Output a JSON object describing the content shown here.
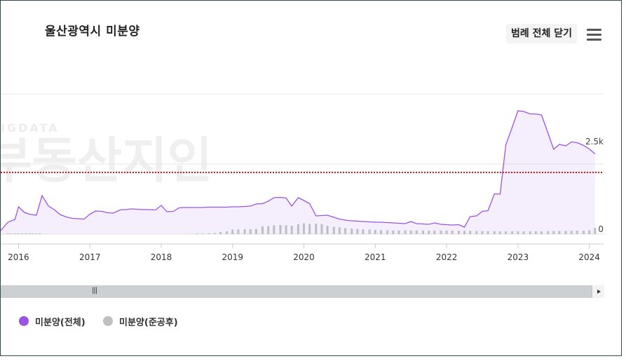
{
  "title": "울산광역시 미분양",
  "legend_toggle_label": "범례 전체 닫기",
  "watermark": {
    "small": "IGDATA",
    "large": "부동산지인"
  },
  "colors": {
    "total": "#9b55e5",
    "completed": "#bfbfbf",
    "reference": "#dd1111",
    "grid": "#e6e6e6"
  },
  "chart_data": {
    "type": "line",
    "title": "울산광역시 미분양",
    "xlabel": "",
    "ylabel": "",
    "x_ticks": [
      "2016",
      "2017",
      "2018",
      "2019",
      "2020",
      "2021",
      "2022",
      "2023",
      "2024"
    ],
    "y_ticks": [
      {
        "value": 0,
        "label": "0"
      },
      {
        "value": 2500,
        "label": "2.5k"
      }
    ],
    "x_range": [
      2015.75,
      2024.2
    ],
    "ylim": [
      0,
      4200
    ],
    "reference_line": {
      "value": 1760,
      "style": "dotted",
      "color": "#dd1111"
    },
    "grid": true,
    "legend_position": "bottom-left",
    "series": [
      {
        "name": "미분양(전체)",
        "type": "area",
        "color": "#9b55e5",
        "points": [
          [
            2015.75,
            100
          ],
          [
            2015.85,
            340
          ],
          [
            2015.95,
            420
          ],
          [
            2016.0,
            780
          ],
          [
            2016.08,
            620
          ],
          [
            2016.15,
            570
          ],
          [
            2016.25,
            540
          ],
          [
            2016.33,
            1100
          ],
          [
            2016.42,
            800
          ],
          [
            2016.5,
            700
          ],
          [
            2016.58,
            560
          ],
          [
            2016.67,
            490
          ],
          [
            2016.75,
            450
          ],
          [
            2016.83,
            440
          ],
          [
            2016.92,
            430
          ],
          [
            2017.0,
            570
          ],
          [
            2017.08,
            660
          ],
          [
            2017.17,
            650
          ],
          [
            2017.25,
            610
          ],
          [
            2017.33,
            600
          ],
          [
            2017.42,
            690
          ],
          [
            2017.5,
            700
          ],
          [
            2017.58,
            720
          ],
          [
            2017.67,
            710
          ],
          [
            2017.75,
            700
          ],
          [
            2017.83,
            700
          ],
          [
            2017.92,
            690
          ],
          [
            2018.0,
            820
          ],
          [
            2018.08,
            640
          ],
          [
            2018.17,
            650
          ],
          [
            2018.25,
            750
          ],
          [
            2018.33,
            760
          ],
          [
            2018.42,
            760
          ],
          [
            2018.5,
            760
          ],
          [
            2018.58,
            760
          ],
          [
            2018.67,
            770
          ],
          [
            2018.75,
            770
          ],
          [
            2018.83,
            770
          ],
          [
            2018.92,
            770
          ],
          [
            2019.0,
            780
          ],
          [
            2019.08,
            780
          ],
          [
            2019.17,
            790
          ],
          [
            2019.25,
            800
          ],
          [
            2019.33,
            860
          ],
          [
            2019.42,
            870
          ],
          [
            2019.5,
            940
          ],
          [
            2019.58,
            1040
          ],
          [
            2019.67,
            1050
          ],
          [
            2019.75,
            1030
          ],
          [
            2019.83,
            800
          ],
          [
            2019.92,
            1040
          ],
          [
            2020.0,
            960
          ],
          [
            2020.08,
            870
          ],
          [
            2020.17,
            520
          ],
          [
            2020.25,
            530
          ],
          [
            2020.33,
            540
          ],
          [
            2020.42,
            480
          ],
          [
            2020.5,
            430
          ],
          [
            2020.58,
            400
          ],
          [
            2020.67,
            380
          ],
          [
            2020.75,
            370
          ],
          [
            2020.83,
            360
          ],
          [
            2020.92,
            350
          ],
          [
            2021.0,
            340
          ],
          [
            2021.08,
            340
          ],
          [
            2021.17,
            330
          ],
          [
            2021.25,
            320
          ],
          [
            2021.33,
            310
          ],
          [
            2021.42,
            300
          ],
          [
            2021.5,
            360
          ],
          [
            2021.58,
            300
          ],
          [
            2021.67,
            290
          ],
          [
            2021.75,
            280
          ],
          [
            2021.83,
            320
          ],
          [
            2021.92,
            280
          ],
          [
            2022.0,
            270
          ],
          [
            2022.08,
            260
          ],
          [
            2022.17,
            270
          ],
          [
            2022.25,
            200
          ],
          [
            2022.33,
            500
          ],
          [
            2022.42,
            520
          ],
          [
            2022.5,
            650
          ],
          [
            2022.58,
            670
          ],
          [
            2022.67,
            1150
          ],
          [
            2022.75,
            1140
          ],
          [
            2022.83,
            2550
          ],
          [
            2022.92,
            3050
          ],
          [
            2023.0,
            3520
          ],
          [
            2023.08,
            3500
          ],
          [
            2023.17,
            3430
          ],
          [
            2023.25,
            3430
          ],
          [
            2023.33,
            3400
          ],
          [
            2023.42,
            2890
          ],
          [
            2023.5,
            2420
          ],
          [
            2023.58,
            2560
          ],
          [
            2023.67,
            2520
          ],
          [
            2023.75,
            2630
          ],
          [
            2023.83,
            2610
          ],
          [
            2023.92,
            2530
          ],
          [
            2024.0,
            2430
          ],
          [
            2024.08,
            2290
          ]
        ]
      },
      {
        "name": "미분양(준공후)",
        "type": "bar",
        "color": "#bfbfbf",
        "points": [
          [
            2015.85,
            15
          ],
          [
            2015.9,
            15
          ],
          [
            2015.95,
            15
          ],
          [
            2016.0,
            15
          ],
          [
            2016.05,
            15
          ],
          [
            2016.1,
            15
          ],
          [
            2016.15,
            15
          ],
          [
            2016.2,
            15
          ],
          [
            2016.25,
            15
          ],
          [
            2016.3,
            15
          ],
          [
            2018.5,
            15
          ],
          [
            2018.58,
            15
          ],
          [
            2018.67,
            15
          ],
          [
            2018.75,
            30
          ],
          [
            2018.83,
            60
          ],
          [
            2018.92,
            80
          ],
          [
            2019.0,
            130
          ],
          [
            2019.08,
            135
          ],
          [
            2019.17,
            140
          ],
          [
            2019.25,
            140
          ],
          [
            2019.33,
            150
          ],
          [
            2019.42,
            220
          ],
          [
            2019.5,
            230
          ],
          [
            2019.58,
            250
          ],
          [
            2019.67,
            260
          ],
          [
            2019.75,
            250
          ],
          [
            2019.83,
            240
          ],
          [
            2019.92,
            280
          ],
          [
            2020.0,
            310
          ],
          [
            2020.08,
            290
          ],
          [
            2020.17,
            300
          ],
          [
            2020.25,
            290
          ],
          [
            2020.33,
            240
          ],
          [
            2020.42,
            210
          ],
          [
            2020.5,
            190
          ],
          [
            2020.58,
            170
          ],
          [
            2020.67,
            160
          ],
          [
            2020.75,
            150
          ],
          [
            2020.83,
            140
          ],
          [
            2020.92,
            130
          ],
          [
            2021.0,
            120
          ],
          [
            2021.08,
            115
          ],
          [
            2021.17,
            110
          ],
          [
            2021.25,
            105
          ],
          [
            2021.33,
            105
          ],
          [
            2021.42,
            105
          ],
          [
            2021.5,
            105
          ],
          [
            2021.58,
            105
          ],
          [
            2021.67,
            100
          ],
          [
            2021.75,
            100
          ],
          [
            2021.83,
            100
          ],
          [
            2021.92,
            100
          ],
          [
            2022.0,
            100
          ],
          [
            2022.08,
            100
          ],
          [
            2022.17,
            100
          ],
          [
            2022.25,
            95
          ],
          [
            2022.33,
            95
          ],
          [
            2022.42,
            90
          ],
          [
            2022.5,
            90
          ],
          [
            2022.58,
            85
          ],
          [
            2022.67,
            85
          ],
          [
            2022.75,
            80
          ],
          [
            2022.83,
            80
          ],
          [
            2022.92,
            80
          ],
          [
            2023.0,
            80
          ],
          [
            2023.08,
            80
          ],
          [
            2023.17,
            80
          ],
          [
            2023.25,
            80
          ],
          [
            2023.33,
            80
          ],
          [
            2023.42,
            85
          ],
          [
            2023.5,
            90
          ],
          [
            2023.58,
            90
          ],
          [
            2023.67,
            95
          ],
          [
            2023.75,
            95
          ],
          [
            2023.83,
            100
          ],
          [
            2023.92,
            100
          ],
          [
            2024.0,
            110
          ],
          [
            2024.08,
            180
          ]
        ]
      }
    ]
  }
}
